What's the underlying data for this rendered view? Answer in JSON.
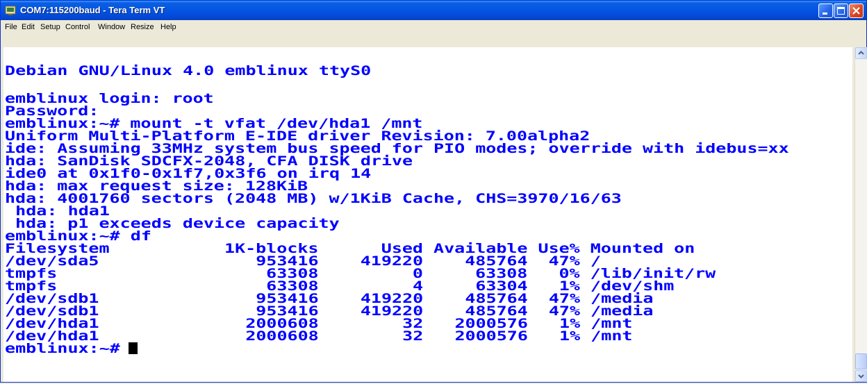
{
  "window": {
    "title": "COM7:115200baud - Tera Term VT",
    "app_icon": "tera-term-icon",
    "controls": {
      "minimize": "minimize-icon",
      "maximize": "maximize-icon",
      "close": "close-icon"
    }
  },
  "menu": [
    "File",
    "Edit",
    "Setup",
    "Control",
    "Window",
    "Resize",
    "Help"
  ],
  "terminal": {
    "text_color": "#0000ff",
    "background": "#ffffff",
    "lines": [
      "Debian GNU/Linux 4.0 emblinux ttyS0",
      "",
      "emblinux login: root",
      "Password:",
      "emblinux:~# mount -t vfat /dev/hda1 /mnt",
      "Uniform Multi-Platform E-IDE driver Revision: 7.00alpha2",
      "ide: Assuming 33MHz system bus speed for PIO modes; override with idebus=xx",
      "hda: SanDisk SDCFX-2048, CFA DISK drive",
      "ide0 at 0x1f0-0x1f7,0x3f6 on irq 14",
      "hda: max request size: 128KiB",
      "hda: 4001760 sectors (2048 MB) w/1KiB Cache, CHS=3970/16/63",
      " hda: hda1",
      " hda: p1 exceeds device capacity",
      "emblinux:~# df",
      "Filesystem           1K-blocks      Used Available Use% Mounted on",
      "/dev/sda5               953416    419220    485764  47% /",
      "tmpfs                    63308         0     63308   0% /lib/init/rw",
      "tmpfs                    63308         4     63304   1% /dev/shm",
      "/dev/sdb1               953416    419220    485764  47% /media",
      "/dev/sdb1               953416    419220    485764  47% /media",
      "/dev/hda1              2000608        32   2000576   1% /mnt",
      "/dev/hda1              2000608        32   2000576   1% /mnt",
      "emblinux:~# "
    ]
  },
  "scrollbar": {
    "up": "scroll-up-arrow-icon",
    "down": "scroll-down-arrow-icon",
    "position": 1.0
  }
}
